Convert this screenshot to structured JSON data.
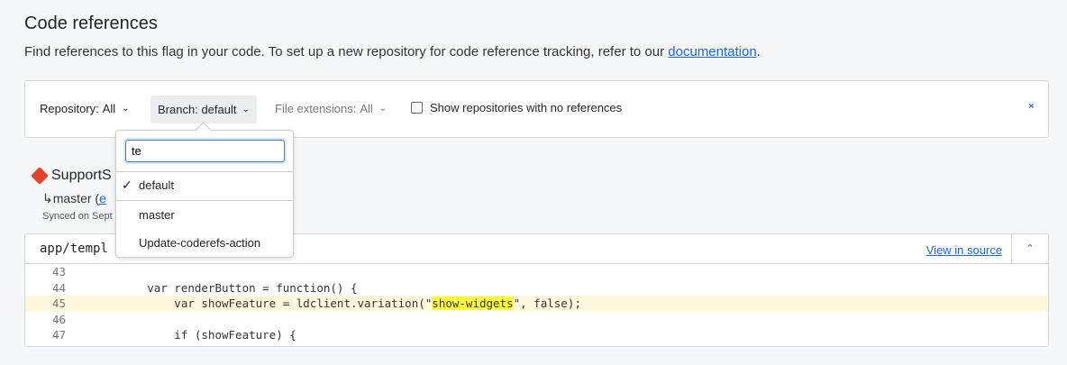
{
  "header": {
    "title": "Code references",
    "description": "Find references to this flag in your code. To set up a new repository for code reference tracking, refer to our ",
    "doc_link": "documentation",
    "period": "."
  },
  "filters": {
    "repository_label": "Repository:",
    "repository_value": "All",
    "branch_label": "Branch:",
    "branch_value": "default",
    "ext_label": "File extensions:",
    "ext_value": "All",
    "show_empty": "Show repositories with no references"
  },
  "dropdown": {
    "search_value": "te",
    "options": [
      {
        "label": "default",
        "selected": true
      },
      {
        "label": "master"
      },
      {
        "label": "Update-coderefs-action"
      }
    ]
  },
  "repo": {
    "name": "SupportS",
    "branch_prefix": "↳master (",
    "branch_link": "e",
    "synced": "Synced on Sept"
  },
  "file": {
    "path": "app/templ",
    "view_in_source": "View in source",
    "lines": [
      {
        "n": "43",
        "pre": "",
        "mark": "",
        "post": ""
      },
      {
        "n": "44",
        "pre": "        var renderButton = function() {",
        "mark": "",
        "post": ""
      },
      {
        "n": "45",
        "pre": "            var showFeature = ldclient.variation(\"",
        "mark": "show-widgets",
        "post": "\", false);"
      },
      {
        "n": "46",
        "pre": "",
        "mark": "",
        "post": ""
      },
      {
        "n": "47",
        "pre": "            if (showFeature) {",
        "mark": "",
        "post": ""
      }
    ]
  },
  "colors": {
    "link": "#1a66e5",
    "highlight": "#ffff3a",
    "accent": "#3b7be8"
  }
}
